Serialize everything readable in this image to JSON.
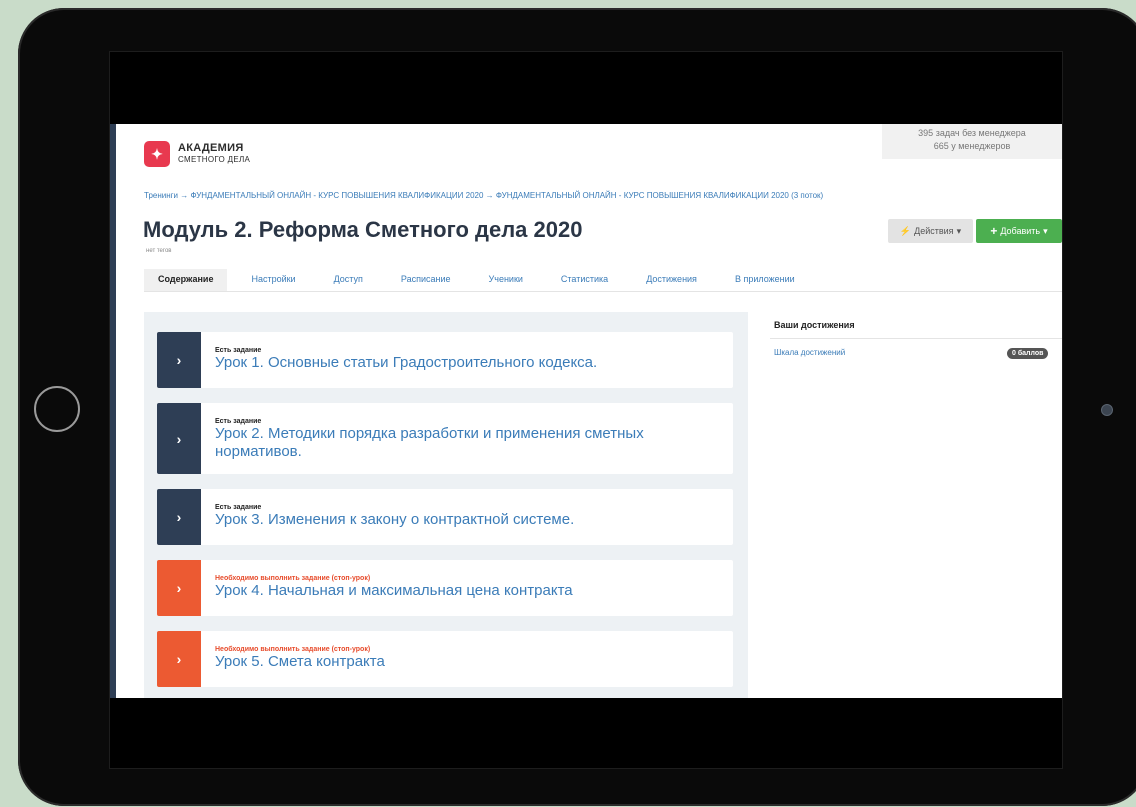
{
  "header": {
    "logo_line1": "АКАДЕМИЯ",
    "logo_line2": "СМЕТНОГО ДЕЛА",
    "tasks_without_manager": "395 задач без менеджера",
    "tasks_with_manager": "665 у менеджеров"
  },
  "breadcrumb": "Тренинги → ФУНДАМЕНТАЛЬНЫЙ ОНЛАЙН - КУРС ПОВЫШЕНИЯ КВАЛИФИКАЦИИ 2020 → ФУНДАМЕНТАЛЬНЫЙ ОНЛАЙН - КУРС ПОВЫШЕНИЯ КВАЛИФИКАЦИИ 2020 (3 поток)",
  "title": "Модуль 2. Реформа Сметного дела 2020",
  "tags_text": "нет тегов",
  "buttons": {
    "actions": "Действия",
    "add": "Добавить"
  },
  "tabs": [
    "Содержание",
    "Настройки",
    "Доступ",
    "Расписание",
    "Ученики",
    "Статистика",
    "Достижения",
    "В приложении"
  ],
  "lessons": [
    {
      "status": "Есть задание",
      "title": "Урок 1. Основные статьи Градостроительного кодекса.",
      "stop": false
    },
    {
      "status": "Есть задание",
      "title": "Урок 2. Методики порядка разработки и применения сметных нормативов.",
      "stop": false
    },
    {
      "status": "Есть задание",
      "title": "Урок 3. Изменения к закону о контрактной системе.",
      "stop": false
    },
    {
      "status": "Необходимо выполнить задание (стоп-урок)",
      "title": "Урок 4. Начальная и максимальная цена контракта",
      "stop": true
    },
    {
      "status": "Необходимо выполнить задание (стоп-урок)",
      "title": "Урок 5. Смета контракта",
      "stop": true
    }
  ],
  "achievements": {
    "heading": "Ваши достижения",
    "link": "Шкала достижений",
    "badge": "0 баллов"
  },
  "colors": {
    "dark_arrow": "#2e3e55",
    "stop_arrow": "#ec5a32",
    "add_green": "#4caf50",
    "logo_red": "#e8394f"
  }
}
